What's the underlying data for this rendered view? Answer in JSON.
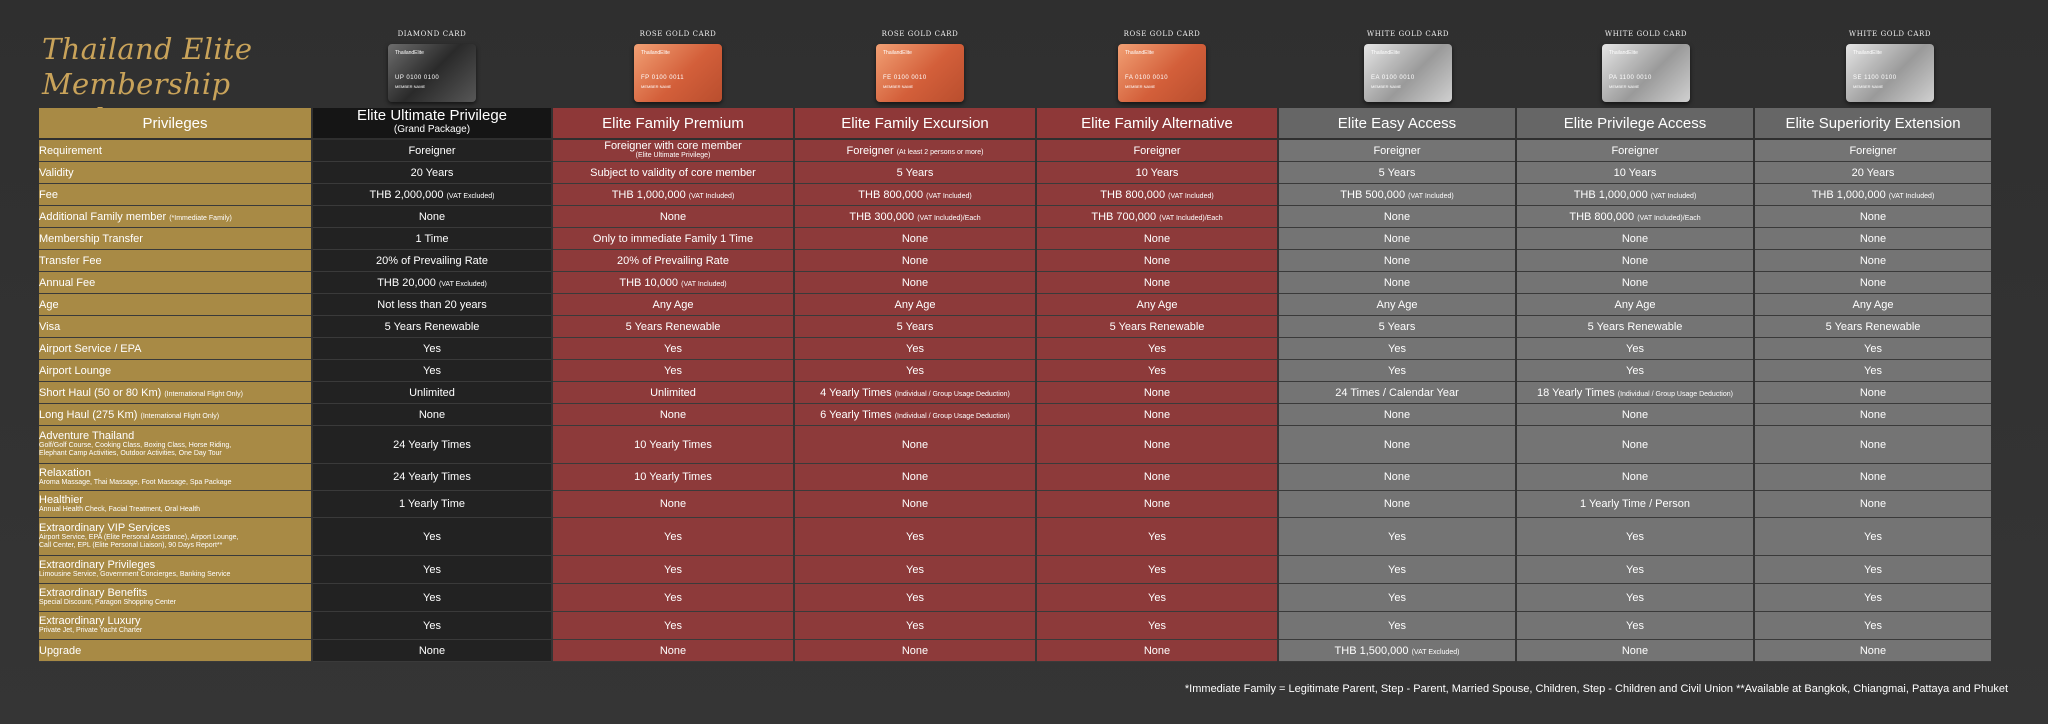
{
  "title_line1": "Thailand Elite",
  "title_line2": "Membership Packages",
  "cards": [
    {
      "label": "DIAMOND CARD",
      "number": "UP 0100 0100",
      "type": "diamond"
    },
    {
      "label": "ROSE GOLD CARD",
      "number": "FP 0100 0011",
      "type": "rose"
    },
    {
      "label": "ROSE GOLD CARD",
      "number": "FE 0100 0010",
      "type": "rose"
    },
    {
      "label": "ROSE GOLD CARD",
      "number": "FA 0100 0010",
      "type": "rose"
    },
    {
      "label": "WHITE GOLD CARD",
      "number": "EA 0100 0010",
      "type": "white"
    },
    {
      "label": "WHITE GOLD CARD",
      "number": "PA 1100 0010",
      "type": "white"
    },
    {
      "label": "WHITE GOLD CARD",
      "number": "SE 1100 0100",
      "type": "white"
    }
  ],
  "card_brand": "ThailandElite",
  "card_member": "MEMBER NAME",
  "headers": {
    "privileges": "Privileges",
    "col1": "Elite Ultimate Privilege",
    "col1_sub": "(Grand Package)",
    "col2": "Elite Family Premium",
    "col3": "Elite Family Excursion",
    "col4": "Elite Family Alternative",
    "col5": "Elite Easy Access",
    "col6": "Elite Privilege Access",
    "col7": "Elite Superiority Extension"
  },
  "rows": {
    "requirement": {
      "label": "Requirement",
      "c1": "Foreigner",
      "c2": "Foreigner with core member",
      "c2s": "(Elite Ultimate Privilege)",
      "c3": "Foreigner",
      "c3s": "(At least 2 persons or more)",
      "c4": "Foreigner",
      "c5": "Foreigner",
      "c6": "Foreigner",
      "c7": "Foreigner"
    },
    "validity": {
      "label": "Validity",
      "c1": "20 Years",
      "c2": "Subject to validity of core member",
      "c3": "5 Years",
      "c4": "10 Years",
      "c5": "5 Years",
      "c6": "10 Years",
      "c7": "20 Years"
    },
    "fee": {
      "label": "Fee",
      "c1": "THB 2,000,000",
      "c1s": "(VAT Excluded)",
      "c2": "THB 1,000,000",
      "c2s": "(VAT Included)",
      "c3": "THB 800,000",
      "c3s": "(VAT Included)",
      "c4": "THB 800,000",
      "c4s": "(VAT Included)",
      "c5": "THB 500,000",
      "c5s": "(VAT Included)",
      "c6": "THB 1,000,000",
      "c6s": "(VAT Included)",
      "c7": "THB 1,000,000",
      "c7s": "(VAT Included)"
    },
    "family": {
      "label": "Additional Family member",
      "labels": "(*Immediate Family)",
      "c1": "None",
      "c2": "None",
      "c3": "THB 300,000",
      "c3s": "(VAT Included)/Each",
      "c4": "THB 700,000",
      "c4s": "(VAT Included)/Each",
      "c5": "None",
      "c6": "THB 800,000",
      "c6s": "(VAT Included)/Each",
      "c7": "None"
    },
    "transfer": {
      "label": "Membership Transfer",
      "c1": "1 Time",
      "c2": "Only to immediate Family 1 Time",
      "c3": "None",
      "c4": "None",
      "c5": "None",
      "c6": "None",
      "c7": "None"
    },
    "transfer_fee": {
      "label": "Transfer Fee",
      "c1": "20% of  Prevailing Rate",
      "c2": "20% of  Prevailing Rate",
      "c3": "None",
      "c4": "None",
      "c5": "None",
      "c6": "None",
      "c7": "None"
    },
    "annual_fee": {
      "label": "Annual Fee",
      "c1": "THB 20,000",
      "c1s": "(VAT Excluded)",
      "c2": "THB 10,000",
      "c2s": "(VAT Included)",
      "c3": "None",
      "c4": "None",
      "c5": "None",
      "c6": "None",
      "c7": "None"
    },
    "age": {
      "label": "Age",
      "c1": "Not less than 20 years",
      "c2": "Any Age",
      "c3": "Any Age",
      "c4": "Any Age",
      "c5": "Any Age",
      "c6": "Any Age",
      "c7": "Any Age"
    },
    "visa": {
      "label": "Visa",
      "c1": "5 Years Renewable",
      "c2": "5 Years Renewable",
      "c3": "5 Years",
      "c4": "5 Years Renewable",
      "c5": "5 Years",
      "c6": "5 Years Renewable",
      "c7": "5 Years Renewable"
    },
    "epa": {
      "label": "Airport Service / EPA",
      "c1": "Yes",
      "c2": "Yes",
      "c3": "Yes",
      "c4": "Yes",
      "c5": "Yes",
      "c6": "Yes",
      "c7": "Yes"
    },
    "lounge": {
      "label": "Airport Lounge",
      "c1": "Yes",
      "c2": "Yes",
      "c3": "Yes",
      "c4": "Yes",
      "c5": "Yes",
      "c6": "Yes",
      "c7": "Yes"
    },
    "short_haul": {
      "label": "Short Haul (50 or 80 Km)",
      "labels": "(International Flight Only)",
      "c1": "Unlimited",
      "c2": "Unlimited",
      "c3": "4 Yearly Times",
      "c3s": "(Individual / Group Usage Deduction)",
      "c4": "None",
      "c5": "24 Times / Calendar Year",
      "c6": "18 Yearly Times",
      "c6s": "(Individual / Group Usage Deduction)",
      "c7": "None"
    },
    "long_haul": {
      "label": "Long Haul (275 Km)",
      "labels": "(International Flight Only)",
      "c1": "None",
      "c2": "None",
      "c3": "6 Yearly Times",
      "c3s": "(Individual / Group Usage Deduction)",
      "c4": "None",
      "c5": "None",
      "c6": "None",
      "c7": "None"
    },
    "adventure": {
      "label": "Adventure Thailand",
      "labels": "Golf/Golf Course, Cooking Class, Boxing Class, Horse Riding,",
      "labels2": "Elephant Camp Activities, Outdoor Activities, One Day Tour",
      "c1": "24 Yearly Times",
      "c2": "10 Yearly Times",
      "c3": "None",
      "c4": "None",
      "c5": "None",
      "c6": "None",
      "c7": "None"
    },
    "relaxation": {
      "label": "Relaxation",
      "labels": "Aroma Massage, Thai Massage, Foot Massage, Spa Package",
      "c1": "24 Yearly Times",
      "c2": "10 Yearly Times",
      "c3": "None",
      "c4": "None",
      "c5": "None",
      "c6": "None",
      "c7": "None"
    },
    "healthier": {
      "label": "Healthier",
      "labels": "Annual Health Check, Facial Treatment, Oral Health",
      "c1": "1 Yearly Time",
      "c2": "None",
      "c3": "None",
      "c4": "None",
      "c5": "None",
      "c6": "1 Yearly Time / Person",
      "c7": "None"
    },
    "vip": {
      "label": "Extraordinary VIP Services",
      "labels": "Airport Service, EPA (Elite Personal Assistance), Airport Lounge,",
      "labels2": "Call Center, EPL (Elite Personal Liaison), 90 Days Report**",
      "c1": "Yes",
      "c2": "Yes",
      "c3": "Yes",
      "c4": "Yes",
      "c5": "Yes",
      "c6": "Yes",
      "c7": "Yes"
    },
    "privileges": {
      "label": "Extraordinary Privileges",
      "labels": "Limousine Service, Government Concierges, Banking Service",
      "c1": "Yes",
      "c2": "Yes",
      "c3": "Yes",
      "c4": "Yes",
      "c5": "Yes",
      "c6": "Yes",
      "c7": "Yes"
    },
    "benefits": {
      "label": "Extraordinary Benefits",
      "labels": "Special Discount, Paragon Shopping Center",
      "c1": "Yes",
      "c2": "Yes",
      "c3": "Yes",
      "c4": "Yes",
      "c5": "Yes",
      "c6": "Yes",
      "c7": "Yes"
    },
    "luxury": {
      "label": "Extraordinary Luxury",
      "labels": "Private Jet, Private Yacht Charter",
      "c1": "Yes",
      "c2": "Yes",
      "c3": "Yes",
      "c4": "Yes",
      "c5": "Yes",
      "c6": "Yes",
      "c7": "Yes"
    },
    "upgrade": {
      "label": "Upgrade",
      "c1": "None",
      "c2": "None",
      "c3": "None",
      "c4": "None",
      "c5": "THB 1,500,000",
      "c5s": "(VAT Excluded)",
      "c6": "None",
      "c7": "None"
    }
  },
  "footnote": "*Immediate Family = Legitimate Parent, Step - Parent, Married Spouse, Children, Step - Children and Civil Union   **Available at Bangkok, Chiangmai, Pattaya and Phuket",
  "colors": {
    "gold": "#a88a45",
    "black": "#222222",
    "red": "#8d3a3a",
    "grey": "#747474",
    "title": "#c9a35a"
  }
}
